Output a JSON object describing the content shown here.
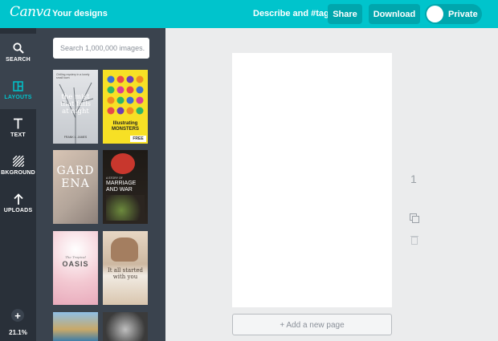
{
  "header": {
    "logo": "Canva",
    "your_designs": "Your designs",
    "describe": "Describe and #tag",
    "share_label": "Share",
    "download_label": "Download",
    "private_label": "Private"
  },
  "sidebar": {
    "items": [
      {
        "label": "SEARCH",
        "icon": "search-icon"
      },
      {
        "label": "LAYOUTS",
        "icon": "layouts-icon"
      },
      {
        "label": "TEXT",
        "icon": "text-icon"
      },
      {
        "label": "BKGROUND",
        "icon": "background-icon"
      },
      {
        "label": "UPLOADS",
        "icon": "upload-icon"
      }
    ],
    "add_label": "+",
    "zoom": "21.1%"
  },
  "panel": {
    "search_placeholder": "Search 1,000,000 images.",
    "layouts": [
      {
        "text": "the mist that falls at night",
        "author": "FRANK L. JAMES",
        "kicker": "Chilling mystery in a lonely small town"
      },
      {
        "text": "Illustrating MONSTERS",
        "badge": "FREE"
      },
      {
        "text": "GARDENA"
      },
      {
        "text": "MARRIAGE AND WAR",
        "kicker": "A STORY OF"
      },
      {
        "text": "OASIS",
        "kicker": "The Tropical"
      },
      {
        "text": "It all started with you"
      },
      {
        "text": ""
      },
      {
        "text": ""
      }
    ]
  },
  "canvas": {
    "page_number": "1",
    "add_page_label": "+ Add a new page"
  },
  "colors": {
    "brand": "#00c4cc",
    "rail": "#293039",
    "panel": "#3a434e"
  }
}
